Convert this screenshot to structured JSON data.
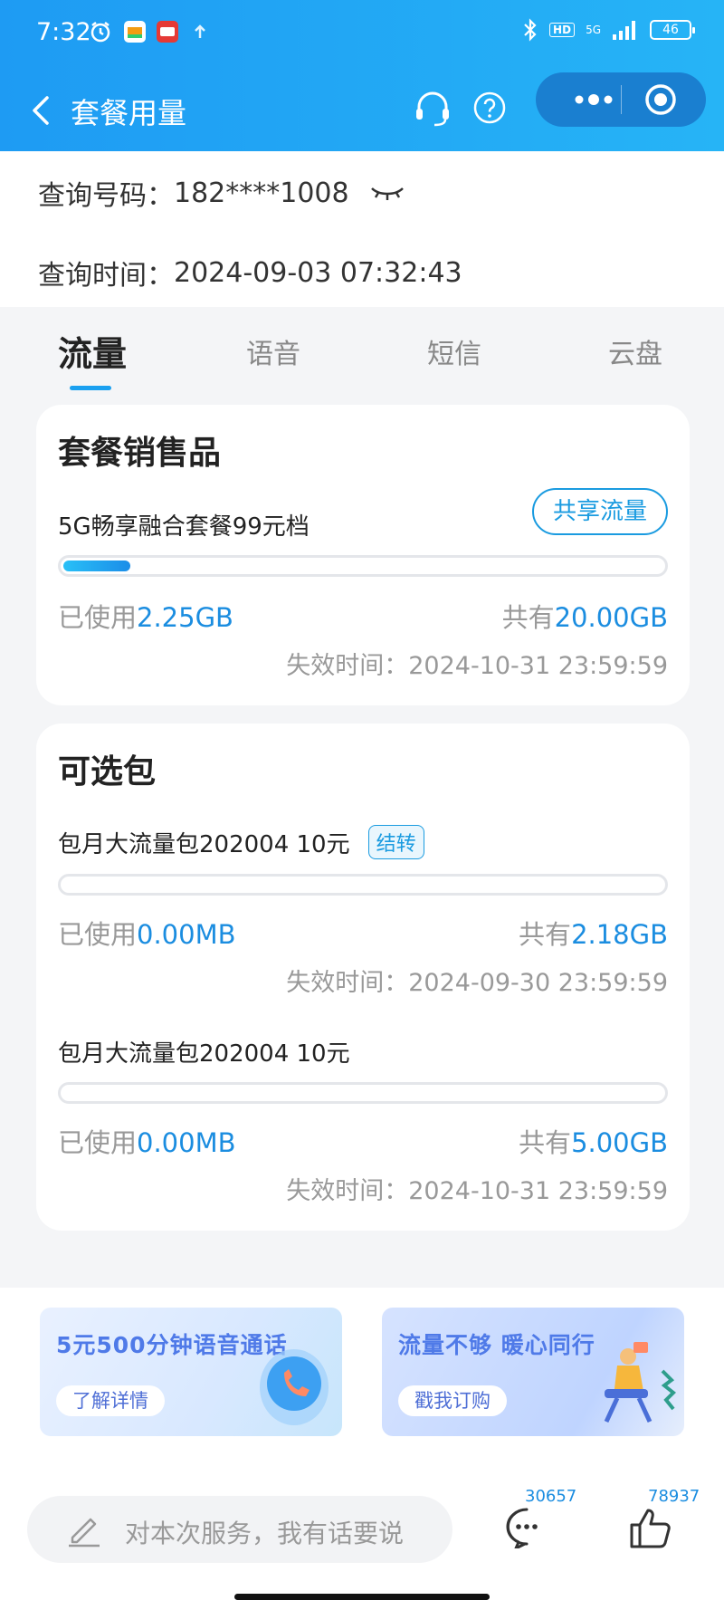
{
  "status_bar": {
    "time": "7:32",
    "network": "5G",
    "hd": "HD",
    "battery": "46"
  },
  "navbar": {
    "title": "套餐用量"
  },
  "query": {
    "number_label": "查询号码：",
    "number_value": "182****1008",
    "time_label": "查询时间：",
    "time_value": "2024-09-03 07:32:43"
  },
  "tabs": [
    {
      "label": "流量",
      "active": true
    },
    {
      "label": "语音",
      "active": false
    },
    {
      "label": "短信",
      "active": false
    },
    {
      "label": "云盘",
      "active": false
    }
  ],
  "plan_card": {
    "title": "套餐销售品",
    "package": {
      "name": "5G畅享融合套餐99元档",
      "share_button": "共享流量",
      "used_label": "已使用",
      "used_value": "2.25GB",
      "total_label": "共有",
      "total_value": "20.00GB",
      "usage_fraction": 0.1125,
      "expire_label": "失效时间：",
      "expire_value": "2024-10-31 23:59:59"
    }
  },
  "optional_card": {
    "title": "可选包",
    "packages": [
      {
        "name": "包月大流量包202004 10元",
        "tag": "结转",
        "used_label": "已使用",
        "used_value": "0.00MB",
        "total_label": "共有",
        "total_value": "2.18GB",
        "usage_fraction": 0,
        "expire_label": "失效时间：",
        "expire_value": "2024-09-30 23:59:59"
      },
      {
        "name": "包月大流量包202004 10元",
        "tag": "",
        "used_label": "已使用",
        "used_value": "0.00MB",
        "total_label": "共有",
        "total_value": "5.00GB",
        "usage_fraction": 0,
        "expire_label": "失效时间：",
        "expire_value": "2024-10-31 23:59:59"
      }
    ]
  },
  "banners": [
    {
      "title": "5元500分钟语音通话",
      "button": "了解详情"
    },
    {
      "title": "流量不够 暖心同行",
      "button": "戳我订购"
    }
  ],
  "bottom_bar": {
    "comment_placeholder": "对本次服务，我有话要说",
    "comment_count": "30657",
    "like_count": "78937"
  },
  "colors": {
    "header": "#1e9bf3",
    "accent": "#1b8de0",
    "progress": "#1aa0f0"
  }
}
